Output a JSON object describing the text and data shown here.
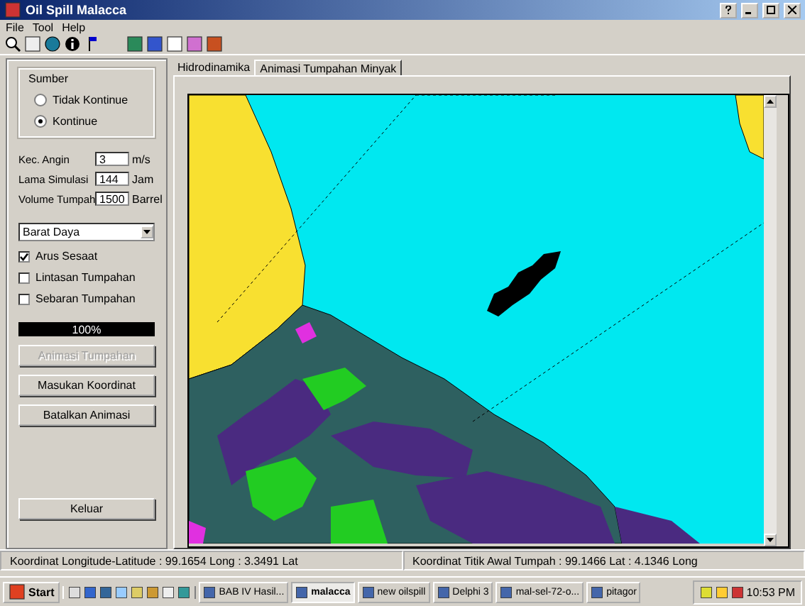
{
  "window": {
    "title": "Oil Spill Malacca"
  },
  "menu": [
    "File",
    "Tool",
    "Help"
  ],
  "sidebar": {
    "source": {
      "label": "Sumber",
      "options": [
        {
          "label": "Tidak Kontinue",
          "selected": false
        },
        {
          "label": "Kontinue",
          "selected": true
        }
      ]
    },
    "fields": [
      {
        "label": "Kec. Angin",
        "value": "3",
        "unit": "m/s"
      },
      {
        "label": "Lama Simulasi",
        "value": "144",
        "unit": "Jam"
      },
      {
        "label": "Volume Tumpah",
        "value": "1500",
        "unit": "Barrel"
      }
    ],
    "direction": "Barat Daya",
    "checkboxes": [
      {
        "label": "Arus Sesaat",
        "checked": true
      },
      {
        "label": "Lintasan Tumpahan",
        "checked": false
      },
      {
        "label": "Sebaran Tumpahan",
        "checked": false
      }
    ],
    "progress": {
      "level": 1,
      "reading": "100%"
    },
    "buttons": [
      {
        "label": "Animasi Tumpahan",
        "disabled": true
      },
      {
        "label": "Masukan Koordinat",
        "disabled": false
      },
      {
        "label": "Batalkan Animasi",
        "disabled": false
      }
    ],
    "exit_button": {
      "label": "Keluar"
    }
  },
  "tabs": [
    {
      "label": "Hidrodinamika",
      "selected": false
    },
    {
      "label": "Animasi Tumpahan Minyak",
      "selected": true
    }
  ],
  "status_bar": [
    "Koordinat Longitude-Latitude : 99.1654 Long : 3.3491 Lat",
    "Koordinat Titik Awal Tumpah : 99.1466 Lat : 4.1346 Long"
  ],
  "taskbar": {
    "start": "Start",
    "tasks": [
      {
        "label": "BAB IV Hasil...",
        "selected": false
      },
      {
        "label": "malacca",
        "selected": true
      },
      {
        "label": "new oilspill",
        "selected": false
      },
      {
        "label": "Delphi 3",
        "selected": false
      },
      {
        "label": "mal-sel-72-o...",
        "selected": false
      },
      {
        "label": "pitagor",
        "selected": false
      }
    ],
    "clock": "10:53 PM"
  }
}
